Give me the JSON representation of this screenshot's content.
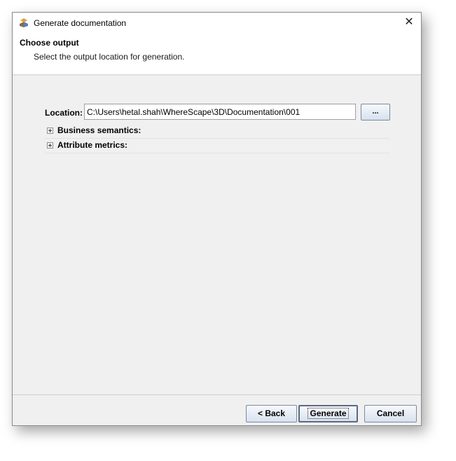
{
  "window": {
    "title": "Generate documentation",
    "close_label": "✕"
  },
  "header": {
    "title": "Choose output",
    "subtitle": "Select the output location for generation."
  },
  "form": {
    "location_label": "Location:",
    "location_value": "C:\\Users\\hetal.shah\\WhereScape\\3D\\Documentation\\001",
    "browse_label": "..."
  },
  "sections": [
    {
      "label": "Business semantics:"
    },
    {
      "label": "Attribute metrics:"
    }
  ],
  "buttons": {
    "back": "< Back",
    "generate": "Generate",
    "cancel": "Cancel"
  }
}
